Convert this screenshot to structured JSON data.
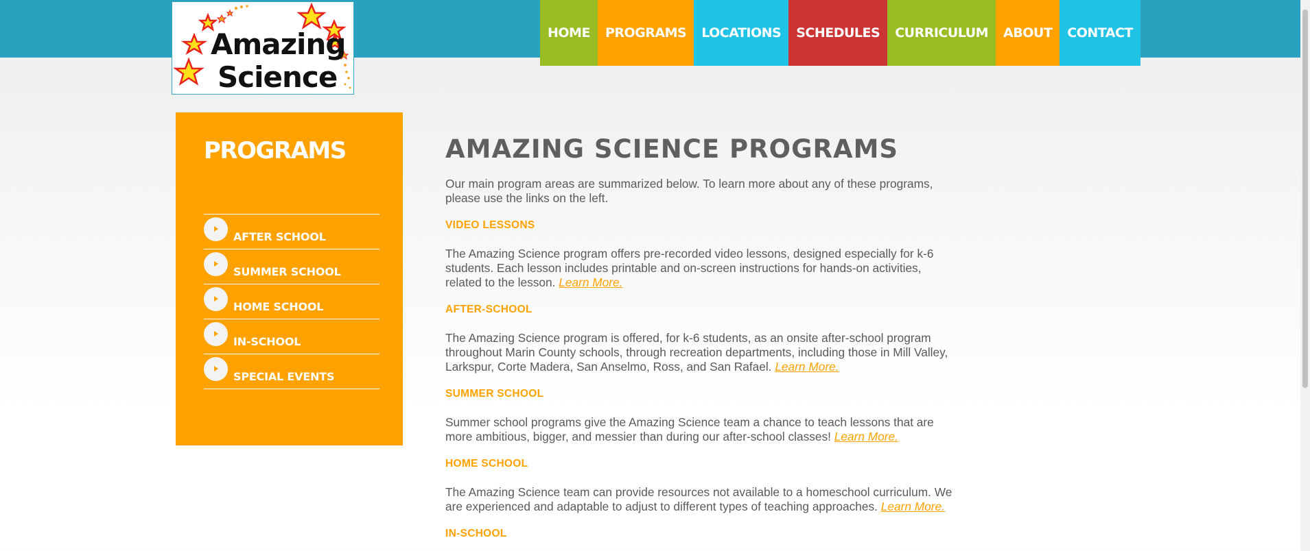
{
  "logo": {
    "line1": "Amazing",
    "line2": "Science"
  },
  "nav": [
    {
      "label": "HOME",
      "color": "#99bc22"
    },
    {
      "label": "PROGRAMS",
      "color": "#ffa200"
    },
    {
      "label": "LOCATIONS",
      "color": "#1ec3e6"
    },
    {
      "label": "SCHEDULES",
      "color": "#cc3333"
    },
    {
      "label": "CURRICULUM",
      "color": "#99bc22"
    },
    {
      "label": "ABOUT",
      "color": "#ffa200"
    },
    {
      "label": "CONTACT",
      "color": "#1ec3e6"
    }
  ],
  "sidebar": {
    "title": "PROGRAMS",
    "items": [
      {
        "label": "AFTER SCHOOL"
      },
      {
        "label": "SUMMER SCHOOL"
      },
      {
        "label": "HOME SCHOOL"
      },
      {
        "label": "IN-SCHOOL"
      },
      {
        "label": "SPECIAL EVENTS"
      }
    ]
  },
  "main": {
    "title": "AMAZING SCIENCE PROGRAMS",
    "intro": "Our main program areas are summarized below. To learn more about any of these programs, please use the links on the left.",
    "learn_more": "Learn More.",
    "sections": [
      {
        "heading": "VIDEO LESSONS",
        "body": "The Amazing Science program offers pre-recorded video lessons, designed especially for k-6 students. Each lesson includes printable and on-screen instructions for hands-on activities, related to the lesson."
      },
      {
        "heading": "AFTER-SCHOOL",
        "body": "The Amazing Science program is offered, for k-6 students, as an onsite after-school program throughout Marin County schools, through recreation departments, including those in Mill Valley, Larkspur, Corte Madera, San Anselmo, Ross, and San Rafael."
      },
      {
        "heading": "SUMMER SCHOOL",
        "body": "Summer school programs give the Amazing Science team a chance to teach lessons that are more ambitious, bigger, and messier than during our after-school classes!"
      },
      {
        "heading": "HOME SCHOOL",
        "body": "The Amazing Science team can provide resources not available to a homeschool curriculum. We are experienced and adaptable to adjust to different types of teaching approaches."
      },
      {
        "heading": "IN-SCHOOL",
        "body": ""
      }
    ]
  },
  "colors": {
    "topbar": "#2aa1bf",
    "sidebar": "#ffa200",
    "accent": "#ffa200",
    "text": "#5a5a5a"
  },
  "icons": {
    "sidebar_item": "arrow-right-icon",
    "logo_decoration": "star-icon"
  }
}
